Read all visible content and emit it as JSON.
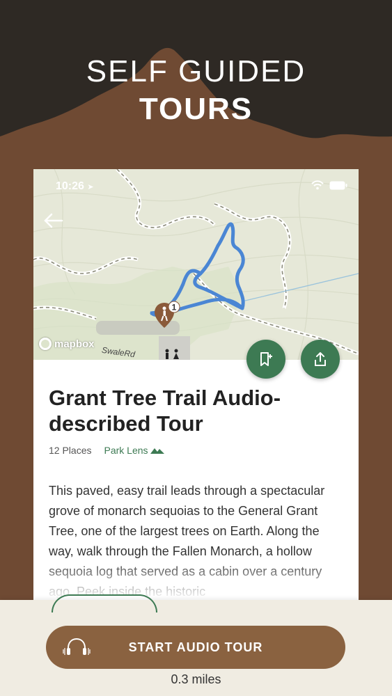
{
  "headline": {
    "line1": "SELF GUIDED",
    "line2": "TOURS"
  },
  "status_bar": {
    "time": "10:26"
  },
  "map": {
    "attribution": "mapbox",
    "road_label": "SwaleRd",
    "marker_number": "1"
  },
  "tour": {
    "title": "Grant Tree Trail Audio-described Tour",
    "places": "12 Places",
    "provider": "Park Lens",
    "description": "This paved, easy trail leads through a spectacular grove of monarch sequoias to the General Grant Tree, one of the largest trees on Earth. Along the way, walk through the Fallen Monarch, a hollow sequoia log that served as a cabin over a century ago. Peek inside the historic"
  },
  "actions": {
    "start_label": "START AUDIO TOUR",
    "distance": "0.3 miles"
  },
  "colors": {
    "background": "#6f4a33",
    "dark_band": "#2e2924",
    "green": "#3d7a53",
    "button": "#8a6240",
    "route": "#4a86d4"
  },
  "icons": [
    "back-arrow-icon",
    "add-bookmark-icon",
    "share-icon",
    "headphones-icon",
    "wifi-icon",
    "battery-icon",
    "location-arrow-icon",
    "hiker-icon",
    "restroom-icon",
    "mountain-icon"
  ]
}
